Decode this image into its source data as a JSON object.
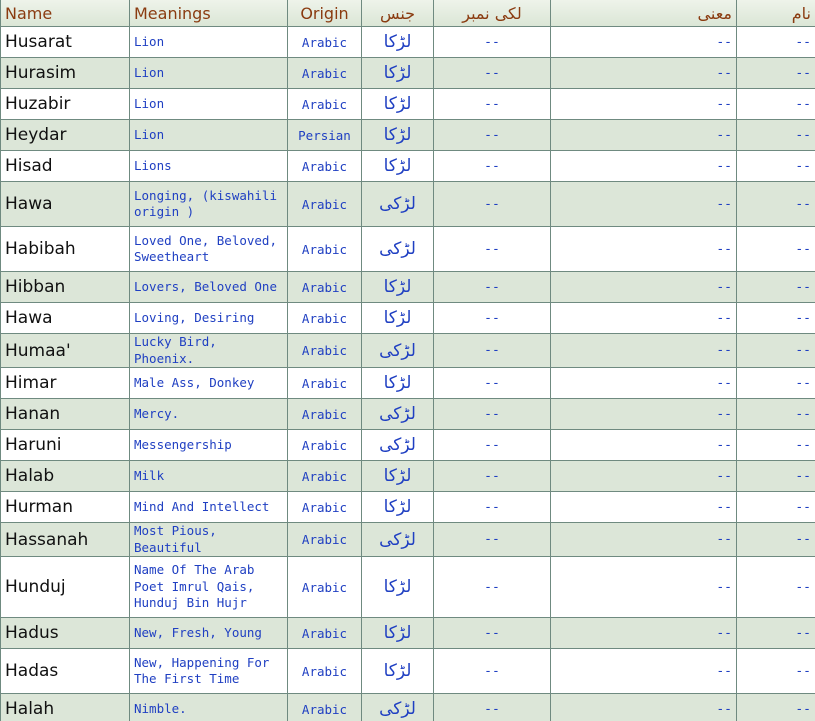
{
  "header": {
    "name": "Name",
    "meanings": "Meanings",
    "origin": "Origin",
    "gender": "جنس",
    "lucky_number": "لکی نمبر",
    "urdu_meaning": "معنی",
    "urdu_name": "نام"
  },
  "rows": [
    {
      "name": "Husarat",
      "meaning": "Lion",
      "origin": "Arabic",
      "gender": "لڑکا",
      "lucky": "--",
      "mani": "--",
      "naam": "--"
    },
    {
      "name": "Hurasim",
      "meaning": "Lion",
      "origin": "Arabic",
      "gender": "لڑکا",
      "lucky": "--",
      "mani": "--",
      "naam": "--"
    },
    {
      "name": "Huzabir",
      "meaning": "Lion",
      "origin": "Arabic",
      "gender": "لڑکا",
      "lucky": "--",
      "mani": "--",
      "naam": "--"
    },
    {
      "name": "Heydar",
      "meaning": "Lion",
      "origin": "Persian",
      "gender": "لڑکا",
      "lucky": "--",
      "mani": "--",
      "naam": "--"
    },
    {
      "name": "Hisad",
      "meaning": "Lions",
      "origin": "Arabic",
      "gender": "لڑکا",
      "lucky": "--",
      "mani": "--",
      "naam": "--"
    },
    {
      "name": "Hawa",
      "meaning": "Longing, (kiswahili origin )",
      "origin": "Arabic",
      "gender": "لڑکی",
      "lucky": "--",
      "mani": "--",
      "naam": "--"
    },
    {
      "name": "Habibah",
      "meaning": "Loved One, Beloved, Sweetheart",
      "origin": "Arabic",
      "gender": "لڑکی",
      "lucky": "--",
      "mani": "--",
      "naam": "--"
    },
    {
      "name": "Hibban",
      "meaning": "Lovers, Beloved One",
      "origin": "Arabic",
      "gender": "لڑکا",
      "lucky": "--",
      "mani": "--",
      "naam": "--"
    },
    {
      "name": "Hawa",
      "meaning": "Loving, Desiring",
      "origin": "Arabic",
      "gender": "لڑکا",
      "lucky": "--",
      "mani": "--",
      "naam": "--"
    },
    {
      "name": "Humaa'",
      "meaning": "Lucky Bird, Phoenix.",
      "origin": "Arabic",
      "gender": "لڑکی",
      "lucky": "--",
      "mani": "--",
      "naam": "--"
    },
    {
      "name": "Himar",
      "meaning": "Male Ass, Donkey",
      "origin": "Arabic",
      "gender": "لڑکا",
      "lucky": "--",
      "mani": "--",
      "naam": "--"
    },
    {
      "name": "Hanan",
      "meaning": "Mercy.",
      "origin": "Arabic",
      "gender": "لڑکی",
      "lucky": "--",
      "mani": "--",
      "naam": "--"
    },
    {
      "name": "Haruni",
      "meaning": "Messengership",
      "origin": "Arabic",
      "gender": "لڑکی",
      "lucky": "--",
      "mani": "--",
      "naam": "--"
    },
    {
      "name": "Halab",
      "meaning": "Milk",
      "origin": "Arabic",
      "gender": "لڑکا",
      "lucky": "--",
      "mani": "--",
      "naam": "--"
    },
    {
      "name": "Hurman",
      "meaning": "Mind And Intellect",
      "origin": "Arabic",
      "gender": "لڑکا",
      "lucky": "--",
      "mani": "--",
      "naam": "--"
    },
    {
      "name": "Hassanah",
      "meaning": "Most Pious, Beautiful",
      "origin": "Arabic",
      "gender": "لڑکی",
      "lucky": "--",
      "mani": "--",
      "naam": "--"
    },
    {
      "name": "Hunduj",
      "meaning": "Name Of The Arab Poet Imrul Qais, Hunduj Bin Hujr",
      "origin": "Arabic",
      "gender": "لڑکا",
      "lucky": "--",
      "mani": "--",
      "naam": "--"
    },
    {
      "name": "Hadus",
      "meaning": "New, Fresh, Young",
      "origin": "Arabic",
      "gender": "لڑکا",
      "lucky": "--",
      "mani": "--",
      "naam": "--"
    },
    {
      "name": "Hadas",
      "meaning": "New, Happening For The First Time",
      "origin": "Arabic",
      "gender": "لڑکا",
      "lucky": "--",
      "mani": "--",
      "naam": "--"
    },
    {
      "name": "Halah",
      "meaning": "Nimble.",
      "origin": "Arabic",
      "gender": "لڑکی",
      "lucky": "--",
      "mani": "--",
      "naam": "--"
    }
  ],
  "colors": {
    "header_text": "#8a3b10",
    "value_text": "#1f3fc2",
    "alt_row": "#dce6d8",
    "border": "#6f8a80"
  }
}
